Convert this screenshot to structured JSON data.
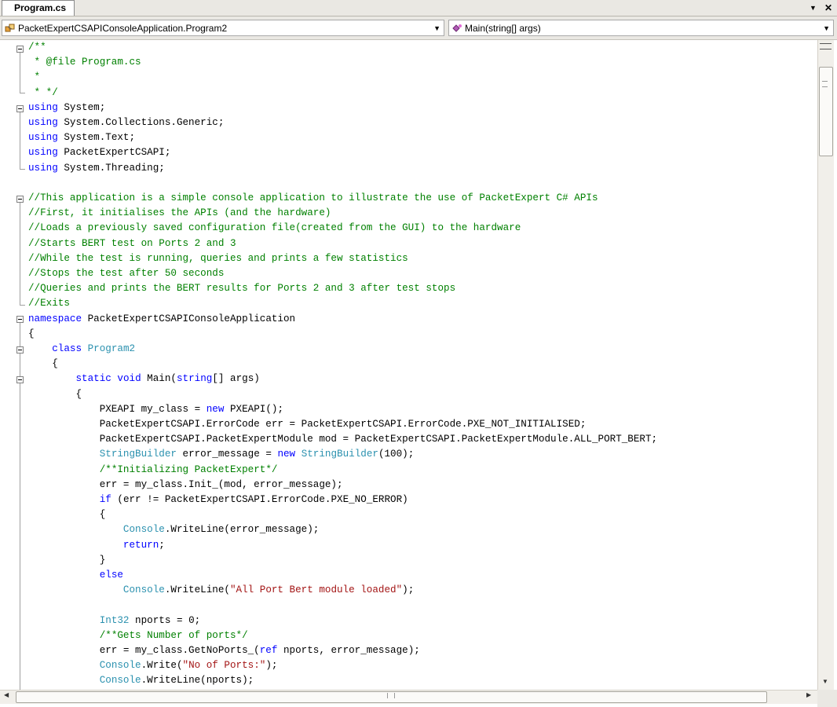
{
  "tab": {
    "title": "Program.cs"
  },
  "tab_controls": {
    "dropdown_glyph": "▼",
    "close_glyph": "✕"
  },
  "nav": {
    "class_combo": "PacketExpertCSAPIConsoleApplication.Program2",
    "member_combo": "Main(string[] args)",
    "arrow_glyph": "▼"
  },
  "scroll": {
    "down": "▼",
    "left": "◀",
    "right": "▶"
  },
  "colors": {
    "keyword": "#0000ff",
    "comment": "#008000",
    "type": "#2b91af",
    "string": "#a31515"
  },
  "code": {
    "l1": [
      "/**"
    ],
    "l2": [
      " * @file Program.cs"
    ],
    "l3": [
      " *"
    ],
    "l4": [
      " * */"
    ],
    "l5": [
      "using",
      " System;"
    ],
    "l6": [
      "using",
      " System.Collections.Generic;"
    ],
    "l7": [
      "using",
      " System.Text;"
    ],
    "l8": [
      "using",
      " PacketExpertCSAPI;"
    ],
    "l9": [
      "using",
      " System.Threading;"
    ],
    "l11": [
      "//This application is a simple console application to illustrate the use of PacketExpert C# APIs"
    ],
    "l12": [
      "//First, it initialises the APIs (and the hardware)"
    ],
    "l13": [
      "//Loads a previously saved configuration file(created from the GUI) to the hardware"
    ],
    "l14": [
      "//Starts BERT test on Ports 2 and 3"
    ],
    "l15": [
      "//While the test is running, queries and prints a few statistics"
    ],
    "l16": [
      "//Stops the test after 50 seconds"
    ],
    "l17": [
      "//Queries and prints the BERT results for Ports 2 and 3 after test stops"
    ],
    "l18": [
      "//Exits"
    ],
    "l19": [
      "namespace",
      " PacketExpertCSAPIConsoleApplication"
    ],
    "l20": [
      "{"
    ],
    "l21": [
      "    ",
      "class",
      " ",
      "Program2"
    ],
    "l22": [
      "    {"
    ],
    "l23": [
      "        ",
      "static",
      " ",
      "void",
      " Main(",
      "string",
      "[] args)"
    ],
    "l24": [
      "        {"
    ],
    "l25": [
      "            PXEAPI my_class = ",
      "new",
      " PXEAPI();"
    ],
    "l26": [
      "            PacketExpertCSAPI.ErrorCode err = PacketExpertCSAPI.ErrorCode.PXE_NOT_INITIALISED;"
    ],
    "l27": [
      "            PacketExpertCSAPI.PacketExpertModule mod = PacketExpertCSAPI.PacketExpertModule.ALL_PORT_BERT;"
    ],
    "l28": [
      "            ",
      "StringBuilder",
      " error_message = ",
      "new",
      " ",
      "StringBuilder",
      "(100);"
    ],
    "l29": [
      "            ",
      "/**Initializing PacketExpert*/"
    ],
    "l30": [
      "            err = my_class.Init_(mod, error_message);"
    ],
    "l31": [
      "            ",
      "if",
      " (err != PacketExpertCSAPI.ErrorCode.PXE_NO_ERROR)"
    ],
    "l32": [
      "            {"
    ],
    "l33": [
      "                ",
      "Console",
      ".WriteLine(error_message);"
    ],
    "l34": [
      "                ",
      "return",
      ";"
    ],
    "l35": [
      "            }"
    ],
    "l36": [
      "            ",
      "else"
    ],
    "l37": [
      "                ",
      "Console",
      ".WriteLine(",
      "\"All Port Bert module loaded\"",
      ");"
    ],
    "l39": [
      "            ",
      "Int32",
      " nports = 0;"
    ],
    "l40": [
      "            ",
      "/**Gets Number of ports*/"
    ],
    "l41": [
      "            err = my_class.GetNoPorts_(",
      "ref",
      " nports, error_message);"
    ],
    "l42": [
      "            ",
      "Console",
      ".Write(",
      "\"No of Ports:\"",
      ");"
    ],
    "l43": [
      "            ",
      "Console",
      ".WriteLine(nports);"
    ]
  }
}
